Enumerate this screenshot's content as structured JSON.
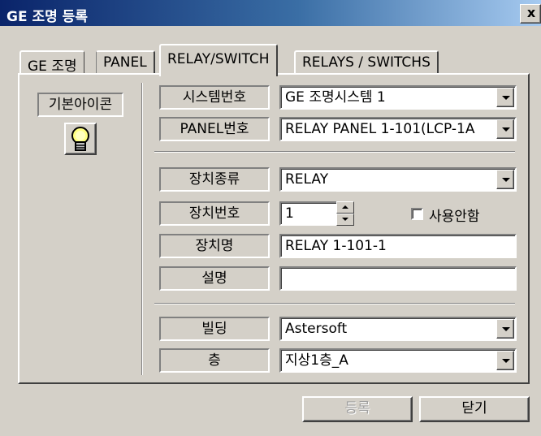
{
  "window": {
    "title": "GE 조명 등록",
    "close_label": "x"
  },
  "tabs": [
    {
      "label": "GE 조명"
    },
    {
      "label": "PANEL"
    },
    {
      "label": "RELAY/SWITCH",
      "active": true
    },
    {
      "label": "RELAYS / SWITCHS"
    }
  ],
  "sidebar": {
    "basic_icon_label": "기본아이콘",
    "icon": "lightbulb-icon"
  },
  "form": {
    "system_no": {
      "label": "시스템번호",
      "value": "GE 조명시스템 1"
    },
    "panel_no": {
      "label": "PANEL번호",
      "value": "RELAY PANEL 1-101(LCP-1A"
    },
    "device_type": {
      "label": "장치종류",
      "value": "RELAY"
    },
    "device_no": {
      "label": "장치번호",
      "value": "1"
    },
    "unused": {
      "label": "사용안함",
      "checked": false
    },
    "device_name": {
      "label": "장치명",
      "value": "RELAY 1-101-1"
    },
    "description": {
      "label": "설명",
      "value": ""
    },
    "building": {
      "label": "빌딩",
      "value": "Astersoft"
    },
    "floor": {
      "label": "층",
      "value": "지상1층_A"
    }
  },
  "buttons": {
    "register": "등록",
    "close": "닫기"
  },
  "colors": {
    "face": "#d4d0c8",
    "title_start": "#0a246a",
    "title_end": "#a6caf0"
  }
}
